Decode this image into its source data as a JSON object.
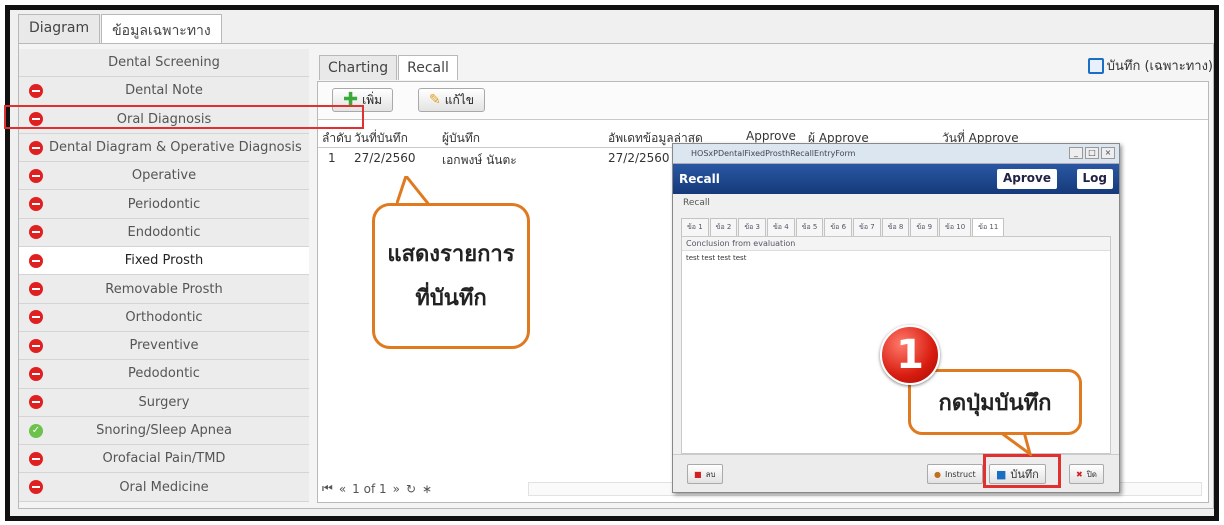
{
  "top_tabs": [
    "Diagram",
    "ข้อมูลเฉพาะทาง"
  ],
  "sidebar": {
    "header": "Dental Screening",
    "items": [
      {
        "label": "Dental Note",
        "icon": "red"
      },
      {
        "label": "Oral Diagnosis",
        "icon": "red"
      },
      {
        "label": "Dental Diagram & Operative Diagnosis",
        "icon": "red"
      },
      {
        "label": "Operative",
        "icon": "red"
      },
      {
        "label": "Periodontic",
        "icon": "red"
      },
      {
        "label": "Endodontic",
        "icon": "red"
      },
      {
        "label": "Fixed Prosth",
        "icon": "red"
      },
      {
        "label": "Removable Prosth",
        "icon": "red"
      },
      {
        "label": "Orthodontic",
        "icon": "red"
      },
      {
        "label": "Preventive",
        "icon": "red"
      },
      {
        "label": "Pedodontic",
        "icon": "red"
      },
      {
        "label": "Surgery",
        "icon": "red"
      },
      {
        "label": "Snoring/Sleep Apnea",
        "icon": "green"
      },
      {
        "label": "Orofacial Pain/TMD",
        "icon": "red"
      },
      {
        "label": "Oral Medicine",
        "icon": "red"
      }
    ]
  },
  "sub_tabs": [
    "Charting",
    "Recall"
  ],
  "save_top_label": "บันทึก (เฉพาะทาง)",
  "toolbar": {
    "add_label": "เพิ่ม",
    "edit_label": "แก้ไข"
  },
  "grid": {
    "headers": [
      "ลำดับ",
      "วันที่บันทึก",
      "ผู้บันทึก",
      "อัพเดทข้อมูลล่าสุด",
      "Approve",
      "ผู้ Approve",
      "วันที่ Approve"
    ],
    "rows": [
      [
        "1",
        "27/2/2560",
        "เอกพงษ์ นันตะ",
        "27/2/2560",
        "",
        "",
        ""
      ]
    ]
  },
  "pager": {
    "text": "1 of 1"
  },
  "callout_left": {
    "line1": "แสดงรายการ",
    "line2": "ที่บันทึก"
  },
  "dialog": {
    "window_title": "HOSxPDentalFixedProsthRecallEntryForm",
    "header": "Recall",
    "approve_label": "Aprove",
    "log_label": "Log",
    "section_label": "Recall",
    "tabs": [
      "ข้อ 1",
      "ข้อ 2",
      "ข้อ 3",
      "ข้อ 4",
      "ข้อ 5",
      "ข้อ 6",
      "ข้อ 7",
      "ข้อ 8",
      "ข้อ 9",
      "ข้อ 10",
      "ข้อ 11"
    ],
    "field_label": "Conclusion from evaluation",
    "field_value": "test  test  test  test",
    "delete_label": "ลบ",
    "instruct_label": "Instruct",
    "save_label": "บันทึก",
    "close_label": "ปิด"
  },
  "badge_number": "1",
  "callout_right": "กดปุ่มบันทึก"
}
